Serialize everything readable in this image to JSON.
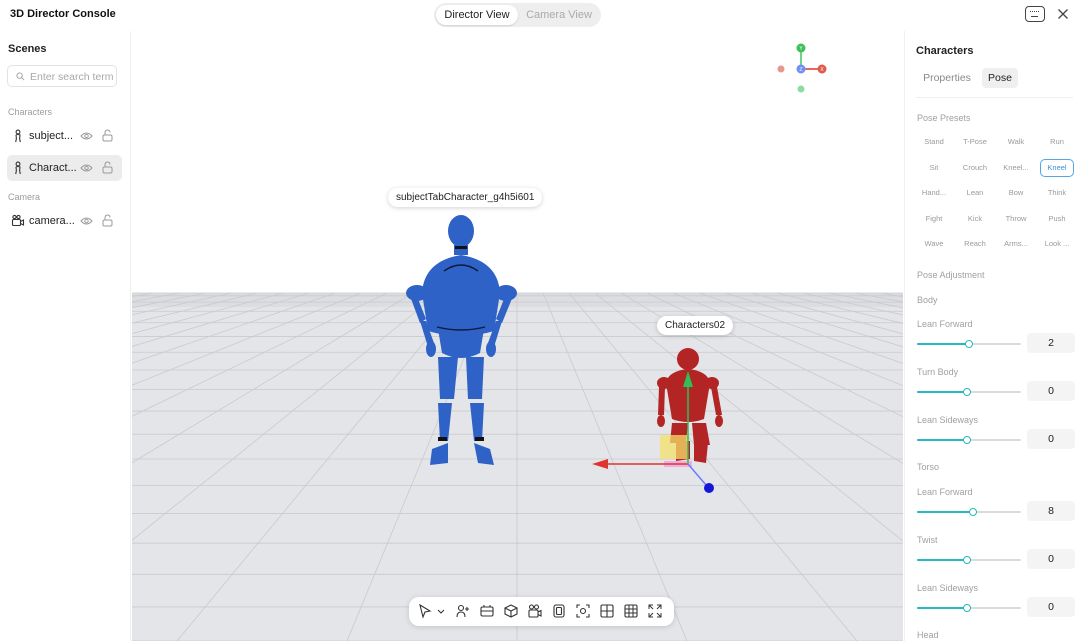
{
  "app": {
    "title": "3D Director Console"
  },
  "view_toggle": {
    "active": "Director View",
    "inactive": "Camera View"
  },
  "sidebar": {
    "title": "Scenes",
    "search_placeholder": "Enter search term",
    "groups": [
      {
        "label": "Characters",
        "items": [
          {
            "label": "subject...",
            "icon": "character-icon",
            "selected": false
          },
          {
            "label": "Charact...",
            "icon": "character-icon",
            "selected": true
          }
        ]
      },
      {
        "label": "Camera",
        "items": [
          {
            "label": "camera...",
            "icon": "camera-icon",
            "selected": false
          }
        ]
      }
    ]
  },
  "viewport": {
    "labels": {
      "char1": "subjectTabCharacter_g4h5i601",
      "char2": "Characters02"
    },
    "gizmo_axes": {
      "y": "Y",
      "z": "Z",
      "x": "X"
    },
    "colors": {
      "char1": "#2f62c6",
      "char2": "#b32424",
      "grid_floor": "#e4e5e8",
      "axis_x": "#e0342f",
      "axis_y": "#2fbf57",
      "axis_z": "#1417d8"
    },
    "toolbar_icons": [
      "select-cursor-icon",
      "chevron-down-icon",
      "add-character-icon",
      "scene-icon",
      "cube-icon",
      "camera-add-icon",
      "frame-icon",
      "focus-icon",
      "layout-grid-icon",
      "grid-icon",
      "fullscreen-icon"
    ]
  },
  "right_panel": {
    "title": "Characters",
    "tabs": [
      "Properties",
      "Pose"
    ],
    "active_tab": "Pose",
    "presets_label": "Pose Presets",
    "presets": [
      [
        "Stand",
        "T-Pose",
        "Walk",
        "Run"
      ],
      [
        "Sit",
        "Crouch",
        "Kneel...",
        "Kneel"
      ],
      [
        "Hand...",
        "Lean",
        "Bow",
        "Think"
      ],
      [
        "Fight",
        "Kick",
        "Throw",
        "Push"
      ],
      [
        "Wave",
        "Reach",
        "Arms...",
        "Look ..."
      ]
    ],
    "active_preset": "Kneel",
    "adjust_label": "Pose Adjustment",
    "body": {
      "label": "Body",
      "sliders": [
        {
          "label": "Lean Forward",
          "value": "2",
          "fraction": 0.5
        },
        {
          "label": "Turn Body",
          "value": "0",
          "fraction": 0.48
        },
        {
          "label": "Lean Sideways",
          "value": "0",
          "fraction": 0.48
        }
      ]
    },
    "torso": {
      "label": "Torso",
      "sliders": [
        {
          "label": "Lean Forward",
          "value": "8",
          "fraction": 0.54
        },
        {
          "label": "Twist",
          "value": "0",
          "fraction": 0.48
        },
        {
          "label": "Lean Sideways",
          "value": "0",
          "fraction": 0.48
        }
      ]
    },
    "head_label": "Head"
  }
}
